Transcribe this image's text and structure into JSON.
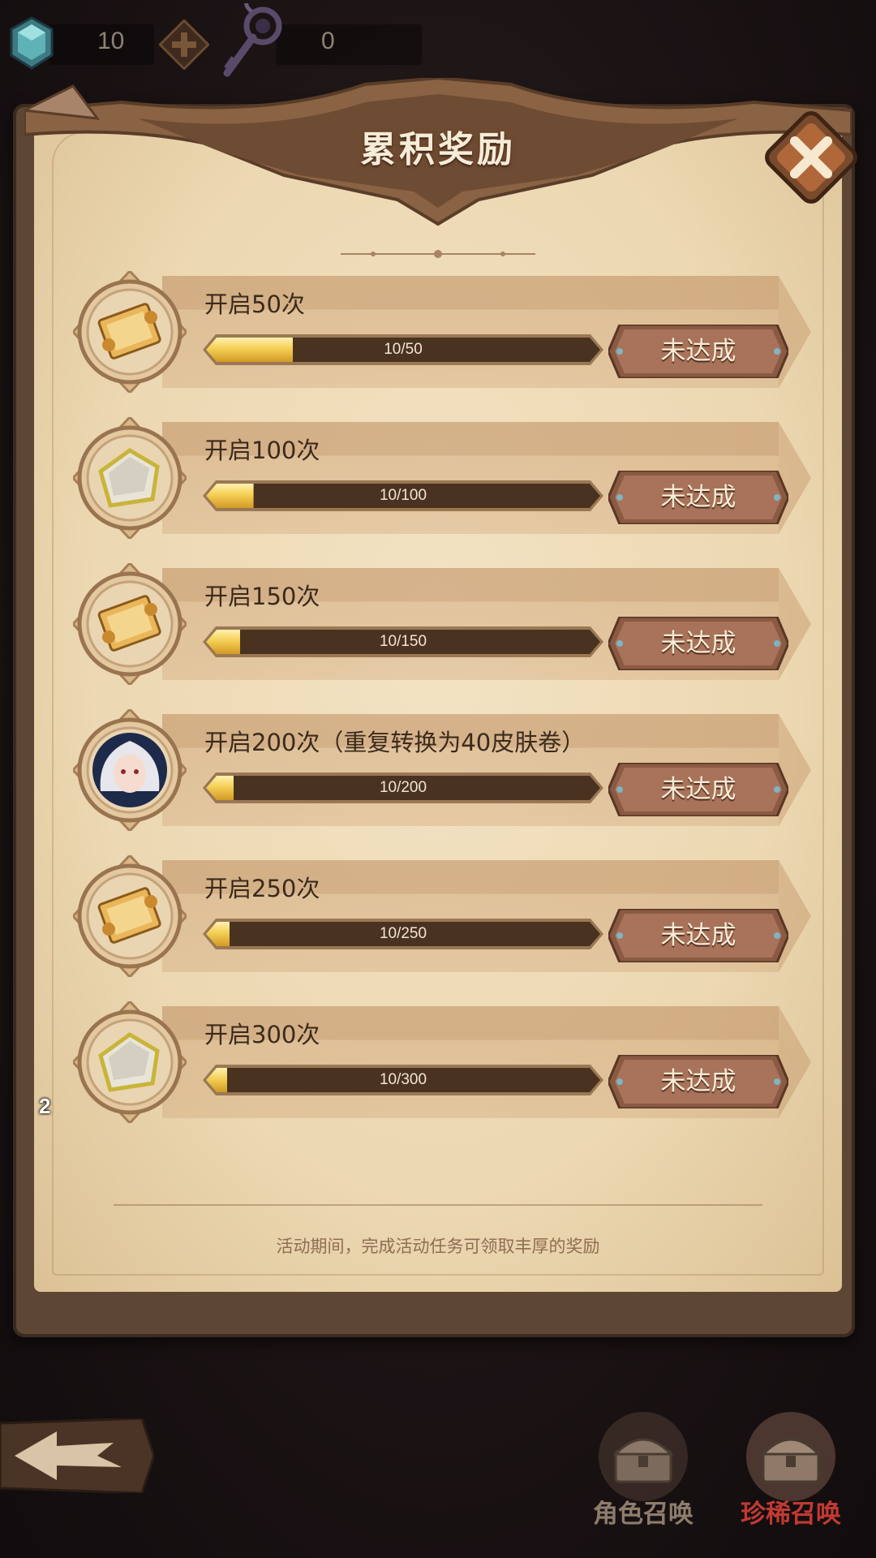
{
  "currency": {
    "gem": {
      "icon": "gem-icon",
      "value": "10"
    },
    "add": {
      "icon": "plus-icon"
    },
    "key": {
      "icon": "key-icon",
      "value": "0"
    }
  },
  "panel": {
    "title": "累积奖励",
    "close_icon": "close-icon",
    "footer_note": "活动期间，完成活动任务可领取丰厚的奖励"
  },
  "rewards": [
    {
      "label": "开启50次",
      "progress_text": "10/50",
      "progress": 0.2,
      "status": "未达成",
      "icon": "scroll-icon"
    },
    {
      "label": "开启100次",
      "progress_text": "10/100",
      "progress": 0.1,
      "status": "未达成",
      "icon": "stone-icon"
    },
    {
      "label": "开启150次",
      "progress_text": "10/150",
      "progress": 0.0667,
      "status": "未达成",
      "icon": "scroll-icon"
    },
    {
      "label": "开启200次（重复转换为40皮肤卷）",
      "progress_text": "10/200",
      "progress": 0.05,
      "status": "未达成",
      "icon": "character-portrait-icon"
    },
    {
      "label": "开启250次",
      "progress_text": "10/250",
      "progress": 0.04,
      "status": "未达成",
      "icon": "scroll-icon"
    },
    {
      "label": "开启300次",
      "progress_text": "10/300",
      "progress": 0.0333,
      "status": "未达成",
      "icon": "stone-icon",
      "count": "2"
    }
  ],
  "nav": {
    "back_icon": "back-arrow-icon",
    "character_summon": {
      "label": "角色召唤",
      "icon": "chest-icon",
      "color": "#8e7c6c"
    },
    "rare_summon": {
      "label": "珍稀召唤",
      "icon": "chest-icon",
      "color": "#c13a32"
    }
  },
  "colors": {
    "parchment": "#ecd8b2",
    "panel_frame": "#5e4634",
    "status_button": "#a8735a",
    "progress_fill": "#f5cf55"
  }
}
